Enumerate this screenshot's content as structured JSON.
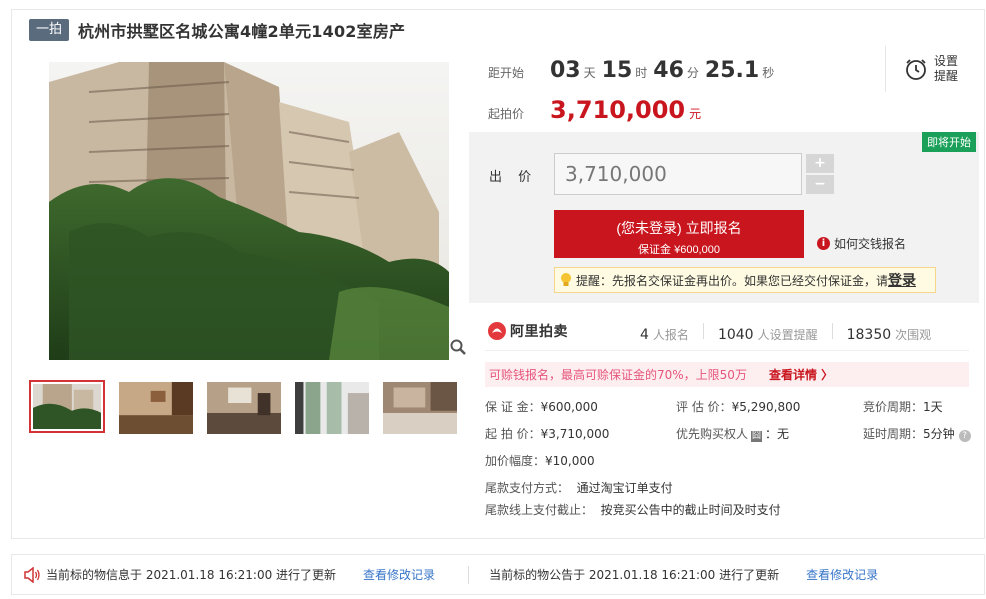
{
  "header": {
    "round_tag": "一拍",
    "title": "杭州市拱墅区名城公寓4幢2单元1402室房产"
  },
  "countdown": {
    "label": "距开始",
    "days": "03",
    "days_unit": "天",
    "hours": "15",
    "hours_unit": "时",
    "minutes": "46",
    "minutes_unit": "分",
    "seconds": "25.1",
    "seconds_unit": "秒"
  },
  "remind": {
    "label": "设置提醒",
    "icon": "alarm-clock-icon"
  },
  "start_price": {
    "label": "起拍价",
    "value": "3,710,000",
    "unit": "元"
  },
  "bid": {
    "status_badge": "即将开始",
    "label": "出 价",
    "value": "3,710,000",
    "plus": "+",
    "minus": "−",
    "signup_main": "(您未登录) 立即报名",
    "signup_sub": "保证金 ¥600,000",
    "how_pay": "如何交钱报名",
    "tip_text": "提醒：先报名交保证金再出价。如果您已经交付保证金，请",
    "tip_login": "登录"
  },
  "stats": {
    "brand": "阿里拍卖",
    "signups": "4",
    "signups_unit": "人报名",
    "reminders": "1040",
    "reminders_unit": "人设置提醒",
    "views": "18350",
    "views_unit": "次围观"
  },
  "loan": {
    "text": "可赊钱报名，最高可赊保证金的70%，上限50万",
    "link": "查看详情 〉"
  },
  "details": {
    "deposit_label": "保 证 金：",
    "deposit": "¥600,000",
    "start_label": "起 拍 价：",
    "start": "¥3,710,000",
    "increment_label": "加价幅度：",
    "increment": "¥10,000",
    "appraisal_label": "评 估 价：",
    "appraisal": "¥5,290,800",
    "priority_label": "优先购买权人",
    "priority_mark": "囧",
    "priority": "：无",
    "cycle_label": "竞价周期：",
    "cycle": "1天",
    "delay_label": "延时周期：",
    "delay": "5分钟",
    "payment_label": "尾款支付方式：",
    "payment": "通过淘宝订单支付",
    "deadline_label": "尾款线上支付截止：",
    "deadline": "按竞买公告中的截止时间及时支付"
  },
  "bottom": {
    "info_updated": "当前标的物信息于 2021.01.18 16:21:00 进行了更新",
    "info_link": "查看修改记录",
    "notice_updated": "当前标的物公告于 2021.01.18 16:21:00 进行了更新",
    "notice_link": "查看修改记录"
  }
}
